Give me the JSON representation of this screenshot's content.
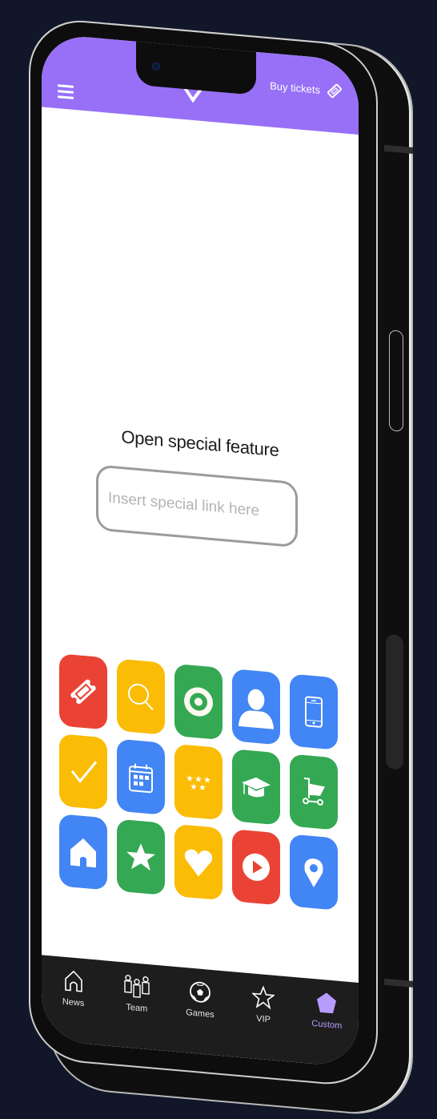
{
  "colors": {
    "background": "#111729",
    "header": "#9770f7",
    "accent": "#b79cff",
    "red": "#ea4335",
    "yellow": "#fbbc05",
    "green": "#34a853",
    "blue": "#4285f4",
    "nav_background": "#1d1d1d"
  },
  "header": {
    "menu_icon": "hamburger-menu-icon",
    "logo_icon": "chevron-down-logo-icon",
    "buy_tickets_label": "Buy tickets",
    "buy_tickets_icon": "ticket-icon"
  },
  "main": {
    "title": "Open special feature",
    "link_input": {
      "value": "",
      "placeholder": "Insert special link here"
    },
    "app_icons": [
      {
        "name": "ticket",
        "color": "red"
      },
      {
        "name": "search",
        "color": "yellow"
      },
      {
        "name": "target",
        "color": "green"
      },
      {
        "name": "person",
        "color": "blue"
      },
      {
        "name": "smartphone",
        "color": "blue"
      },
      {
        "name": "checkmark",
        "color": "yellow"
      },
      {
        "name": "calendar",
        "color": "blue"
      },
      {
        "name": "stars-rating",
        "color": "yellow"
      },
      {
        "name": "graduation-cap",
        "color": "green"
      },
      {
        "name": "shopping-cart",
        "color": "green"
      },
      {
        "name": "home",
        "color": "blue"
      },
      {
        "name": "star",
        "color": "green"
      },
      {
        "name": "heart",
        "color": "yellow"
      },
      {
        "name": "play",
        "color": "red"
      },
      {
        "name": "location-pin",
        "color": "blue"
      }
    ]
  },
  "bottom_nav": {
    "items": [
      {
        "label": "News",
        "icon": "home-icon",
        "active": false
      },
      {
        "label": "Team",
        "icon": "team-icon",
        "active": false
      },
      {
        "label": "Games",
        "icon": "soccer-ball-icon",
        "active": false
      },
      {
        "label": "VIP",
        "icon": "star-icon",
        "active": false
      },
      {
        "label": "Custom",
        "icon": "pentagon-icon",
        "active": true
      }
    ]
  }
}
